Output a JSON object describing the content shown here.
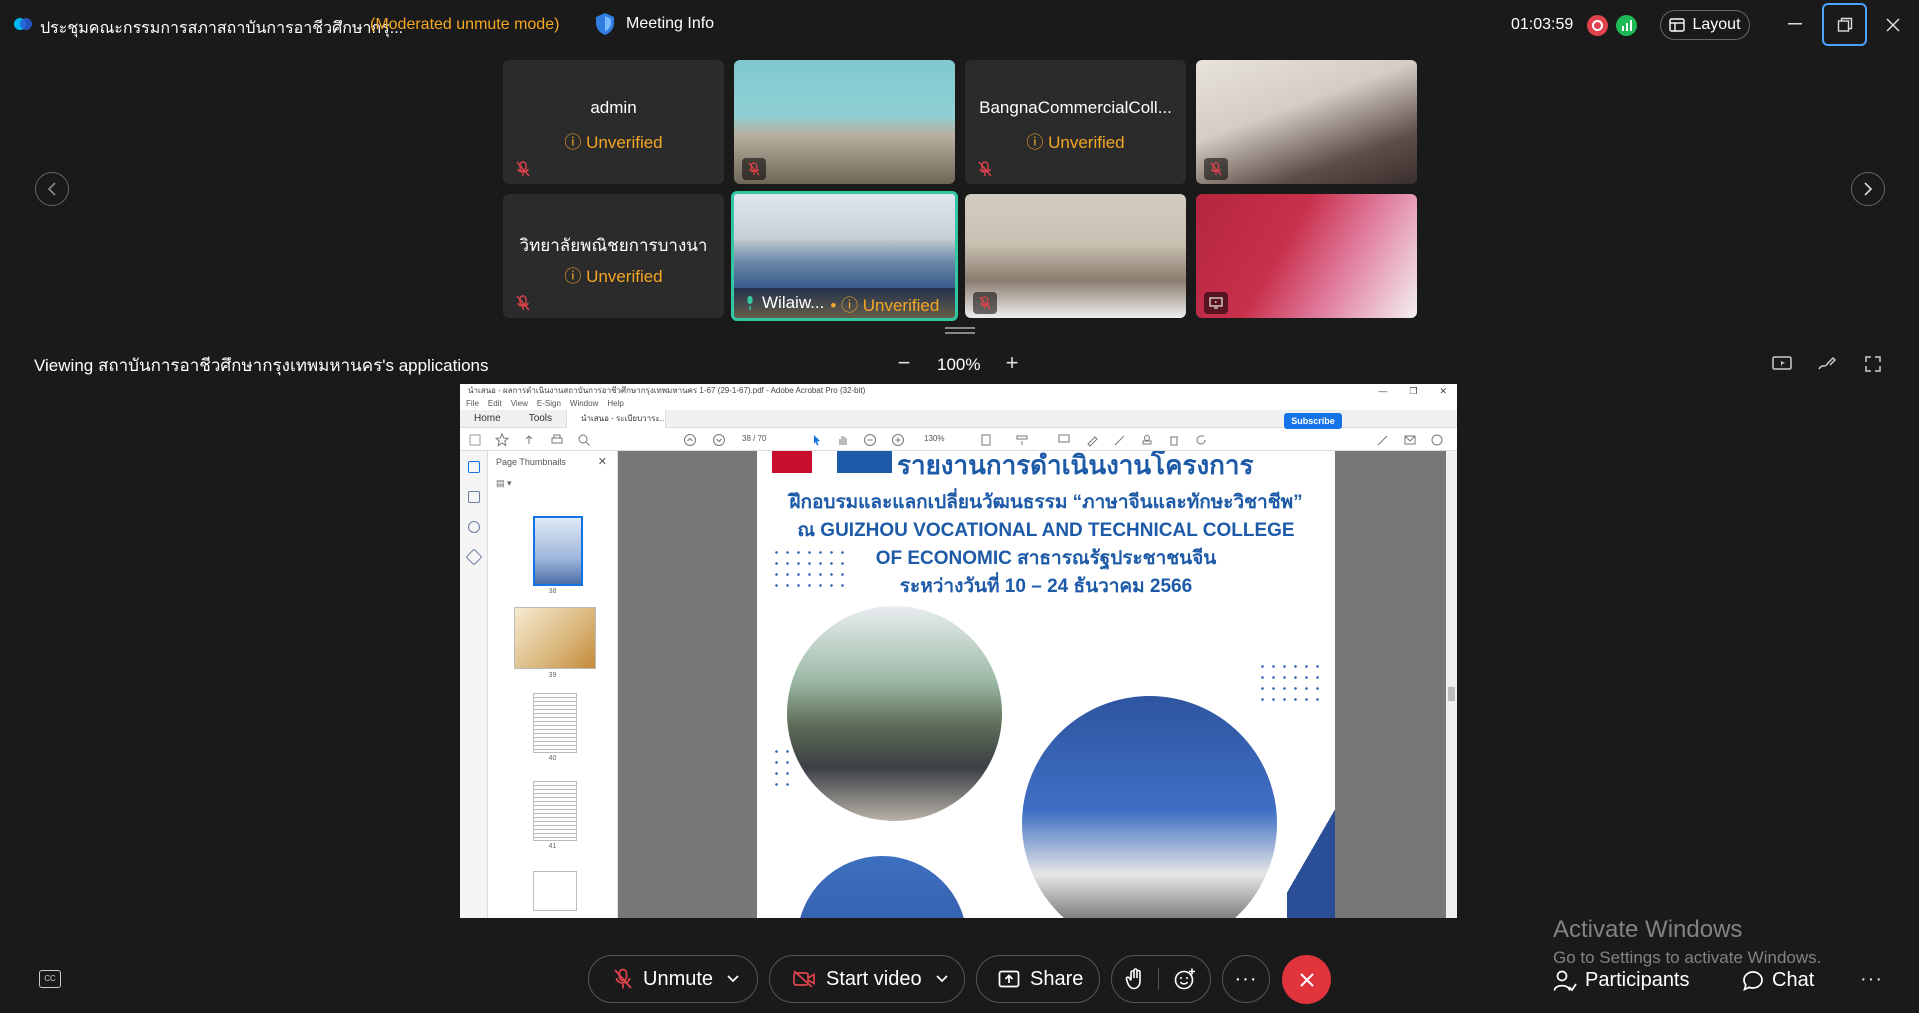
{
  "titlebar": {
    "meeting_title": "ประชุมคณะกรรมการสภาสถาบันการอาชีวศึกษากรุ...",
    "mode": "(Moderated unmute mode)",
    "meeting_info": "Meeting Info",
    "timer": "01:03:59",
    "layout": "Layout"
  },
  "participants": [
    {
      "name": "admin",
      "status": "Unverified",
      "video": false
    },
    {
      "name": "",
      "status": "",
      "video": true
    },
    {
      "name": "BangnaCommercialColl...",
      "status": "Unverified",
      "video": false
    },
    {
      "name": "",
      "status": "",
      "video": true
    },
    {
      "name": "วิทยาลัยพณิชยการบางนา",
      "status": "Unverified",
      "video": false
    },
    {
      "name": "Wilaiw...",
      "status": "Unverified",
      "video": true,
      "speaking": true
    },
    {
      "name": "",
      "status": "",
      "video": true
    },
    {
      "name": "",
      "status": "",
      "video": true
    }
  ],
  "share": {
    "viewing": "Viewing สถาบันการอาชีวศึกษากรุงเทพมหานคร's applications",
    "zoom": "100%",
    "zoom_minus": "−",
    "zoom_plus": "+"
  },
  "acrobat": {
    "title": "นำเสนอ - ผลการดำเนินงานสถาบันการอาชีวศึกษากรุงเทพมหานคร 1-67 (29-1-67).pdf - Adobe Acrobat Pro (32-bit)",
    "menu": [
      "File",
      "Edit",
      "View",
      "E-Sign",
      "Window",
      "Help"
    ],
    "tabs": [
      "Home",
      "Tools",
      "นำเสนอ - ระเบียบวาระ..."
    ],
    "subscribe": "Subscribe",
    "page_current": "38",
    "page_total": "/ 70",
    "zoom": "130%",
    "thumb_panel_title": "Page Thumbnails",
    "thumb_numbers": [
      "38",
      "39",
      "40",
      "41"
    ],
    "page_heading_top": "รายงานการดำเนินงานโครงการ",
    "page_lines": [
      "ฝึกอบรมและแลกเปลี่ยนวัฒนธรรม “ภาษาจีนและทักษะวิชาชีพ”",
      "ณ GUIZHOU VOCATIONAL AND TECHNICAL COLLEGE",
      "OF ECONOMIC สาธารณรัฐประชาชนจีน",
      "ระหว่างวันที่ 10 – 24 ธันวาคม 2566"
    ]
  },
  "bottombar": {
    "unmute": "Unmute",
    "start_video": "Start video",
    "share": "Share",
    "participants": "Participants",
    "chat": "Chat",
    "more": "···",
    "cc": "CC"
  },
  "watermark": {
    "line1": "Activate Windows",
    "line2": "Go to Settings to activate Windows."
  },
  "colors": {
    "background": "#1a1a1a",
    "tile": "#2b2b2b",
    "unverified": "#f5a623",
    "active_border": "#33c6a3",
    "end_call": "#e0333c",
    "focus_ring": "#4aa3ff"
  },
  "icons": [
    "webex-logo-icon",
    "shield-icon",
    "record-icon",
    "network-stats-icon",
    "layout-icon",
    "minimize-icon",
    "restore-icon",
    "close-icon",
    "mic-muted-icon",
    "chevron-left-icon",
    "chevron-right-icon",
    "speaker-icon",
    "video-off-icon",
    "share-icon",
    "raise-hand-icon",
    "reactions-icon",
    "end-call-icon",
    "participants-icon",
    "chat-icon",
    "captions-icon"
  ]
}
